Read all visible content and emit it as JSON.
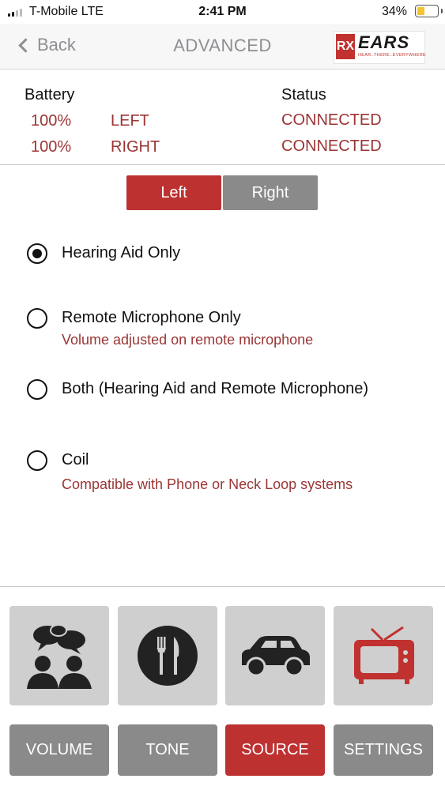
{
  "status_bar": {
    "carrier": "T-Mobile  LTE",
    "time": "2:41 PM",
    "battery_percent": "34%"
  },
  "nav": {
    "back_label": "Back",
    "title": "ADVANCED",
    "logo": {
      "rx": "RX",
      "brand": "EARS",
      "tagline": "HEAR..THERE..EVERYWHERE"
    }
  },
  "info": {
    "battery_header": "Battery",
    "status_header": "Status",
    "rows": [
      {
        "battery": "100%",
        "side": "LEFT",
        "status": "CONNECTED"
      },
      {
        "battery": "100%",
        "side": "RIGHT",
        "status": "CONNECTED"
      }
    ]
  },
  "segment": {
    "left_label": "Left",
    "right_label": "Right",
    "selected": "Left"
  },
  "options": [
    {
      "label": "Hearing Aid Only",
      "sub": "",
      "selected": true
    },
    {
      "label": "Remote Microphone Only",
      "sub": "Volume adjusted on remote microphone",
      "selected": false
    },
    {
      "label": "Both (Hearing Aid and Remote Microphone)",
      "sub": "",
      "selected": false
    },
    {
      "label": "Coil",
      "sub": "Compatible with Phone or Neck Loop systems",
      "selected": false
    }
  ],
  "program_tiles": [
    {
      "icon": "conversation-icon"
    },
    {
      "icon": "restaurant-icon"
    },
    {
      "icon": "car-icon"
    },
    {
      "icon": "tv-icon"
    }
  ],
  "tabs": {
    "volume": "VOLUME",
    "tone": "TONE",
    "source": "SOURCE",
    "settings": "SETTINGS",
    "active": "SOURCE"
  },
  "colors": {
    "accent_red": "#be3131",
    "value_red": "#9b3535",
    "inactive_gray": "#8a8a8a",
    "tile_gray": "#cfcfcf"
  }
}
